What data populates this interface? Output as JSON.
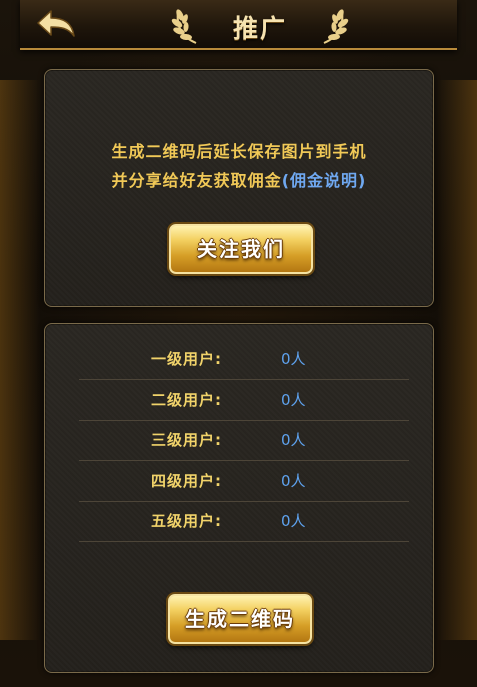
{
  "header": {
    "title": "推广",
    "back_icon": "back-arrow-icon",
    "laurel_icon": "laurel-icon"
  },
  "promo": {
    "line1": "生成二维码后延长保存图片到手机",
    "line2_prefix": "并分享给好友获取佣金",
    "link_open": "(",
    "link_text": "佣金说明",
    "link_close": ")",
    "follow_button": "关注我们"
  },
  "users": [
    {
      "label": "一级用户:",
      "value": "0人"
    },
    {
      "label": "二级用户:",
      "value": "0人"
    },
    {
      "label": "三级用户:",
      "value": "0人"
    },
    {
      "label": "四级用户:",
      "value": "0人"
    },
    {
      "label": "五级用户:",
      "value": "0人"
    }
  ],
  "generate_button": "生成二维码",
  "colors": {
    "accent_gold": "#f1c957",
    "link_blue": "#6fa8f0",
    "value_blue": "#5ea2ee",
    "header_border": "#b88a3a"
  }
}
